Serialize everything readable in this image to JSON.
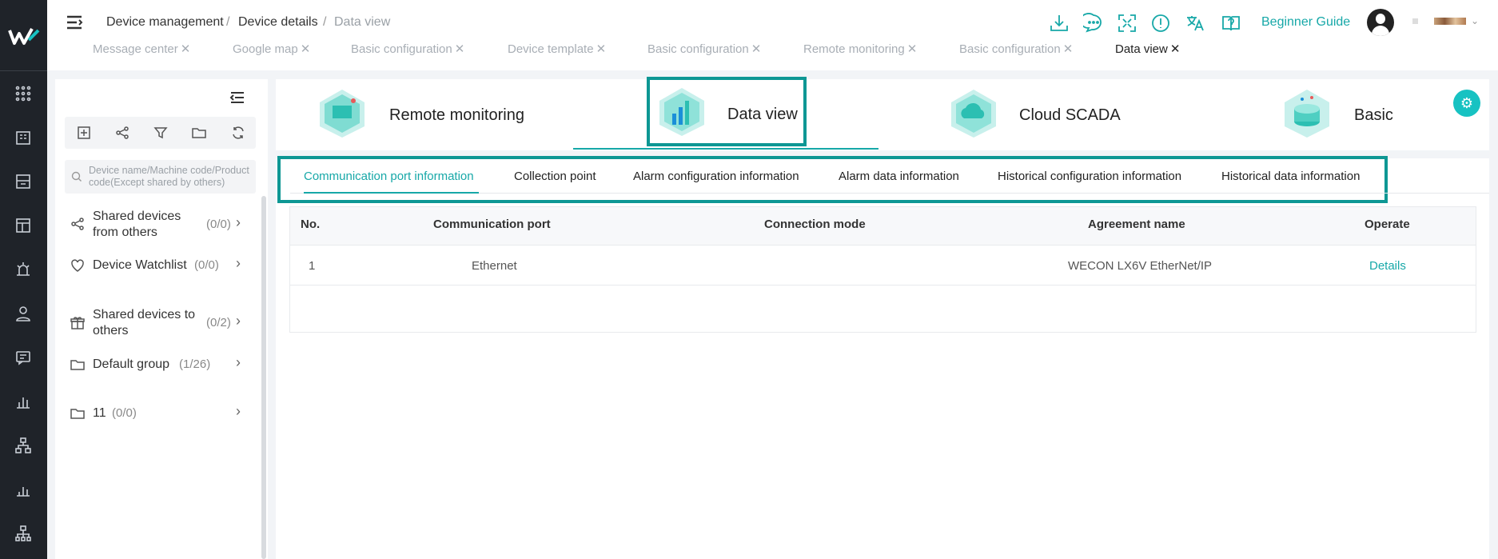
{
  "breadcrumb": {
    "items": [
      "Device management",
      "Device details",
      "Data view"
    ],
    "sep": "/"
  },
  "header": {
    "guide_label": "Beginner Guide"
  },
  "tabs": [
    {
      "label": "Message center"
    },
    {
      "label": "Google map"
    },
    {
      "label": "Basic configuration"
    },
    {
      "label": "Device template"
    },
    {
      "label": "Basic configuration"
    },
    {
      "label": "Remote monitoring"
    },
    {
      "label": "Basic configuration"
    },
    {
      "label": "Data view"
    }
  ],
  "search": {
    "placeholder": "Device name/Machine code/Product code(Except shared by others)"
  },
  "tree": [
    {
      "label": "Shared devices from others",
      "count": "(0/0)"
    },
    {
      "label": "Device Watchlist",
      "count": "(0/0)"
    },
    {
      "label": "Shared devices to others",
      "count": "(0/2)"
    },
    {
      "label": "Default group",
      "count": "(1/26)"
    },
    {
      "label": "11",
      "count": "(0/0)"
    }
  ],
  "cards": [
    {
      "title": "Remote monitoring"
    },
    {
      "title": "Data view"
    },
    {
      "title": "Cloud SCADA"
    },
    {
      "title": "Basic"
    }
  ],
  "subtabs": [
    "Communication port information",
    "Collection point",
    "Alarm configuration information",
    "Alarm data information",
    "Historical configuration information",
    "Historical data information"
  ],
  "table": {
    "headers": [
      "No.",
      "Communication port",
      "Connection mode",
      "Agreement name",
      "Operate"
    ],
    "rows": [
      {
        "no": "1",
        "port": "Ethernet",
        "mode": "",
        "agreement": "WECON LX6V EtherNet/IP",
        "operate": "Details"
      }
    ]
  },
  "colors": {
    "accent": "#17a8a8",
    "highlight": "#0e9794",
    "rail": "#1f2329"
  }
}
